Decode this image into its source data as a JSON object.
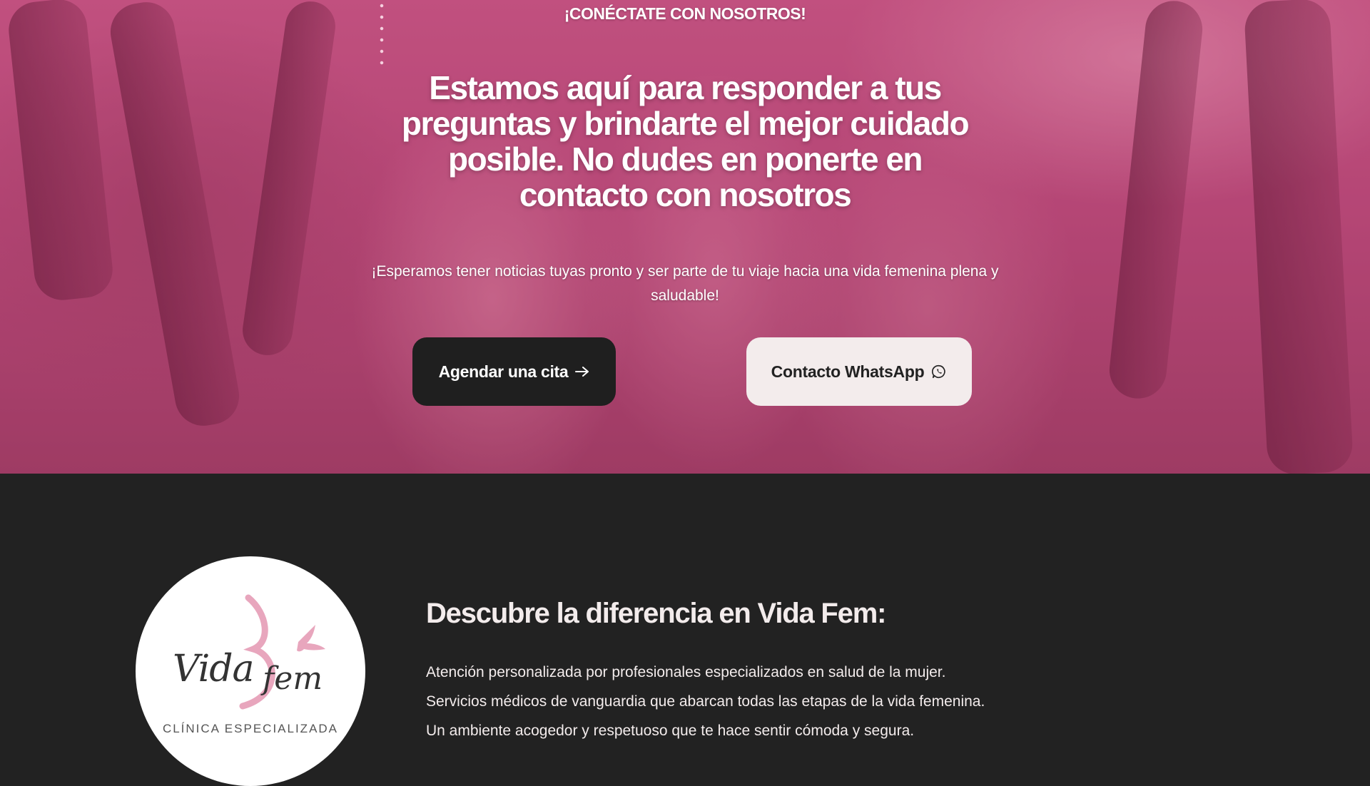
{
  "hero": {
    "eyebrow": "¡CONÉCTATE CON NOSOTROS!",
    "headline": "Estamos aquí para responder a tus preguntas y brindarte el mejor cuidado posible. No dudes en ponerte en contacto con nosotros",
    "subtext": "¡Esperamos tener noticias tuyas pronto y ser parte de tu viaje hacia una vida femenina plena y saludable!",
    "primary_button": "Agendar una cita",
    "secondary_button": "Contacto WhatsApp"
  },
  "about": {
    "logo_script_left": "Vida",
    "logo_script_right": "fem",
    "logo_tagline": "CLÍNICA ESPECIALIZADA",
    "title": "Descubre la diferencia en Vida Fem:",
    "features": [
      "Atención personalizada por profesionales especializados en salud de la mujer.",
      "Servicios médicos de vanguardia que abarcan todas las etapas de la vida femenina.",
      "Un ambiente acogedor y respetuoso que te hace sentir cómoda y segura."
    ]
  },
  "colors": {
    "hero_tint": "#b84c7b",
    "dark_bg": "#222222",
    "button_dark": "#1f1f1f",
    "button_light": "#f3ecec",
    "logo_pink": "#e8a6bd"
  },
  "icons": {
    "primary_button": "arrow-right-icon",
    "secondary_button": "whatsapp-icon",
    "logo_mark": "bird-icon"
  }
}
